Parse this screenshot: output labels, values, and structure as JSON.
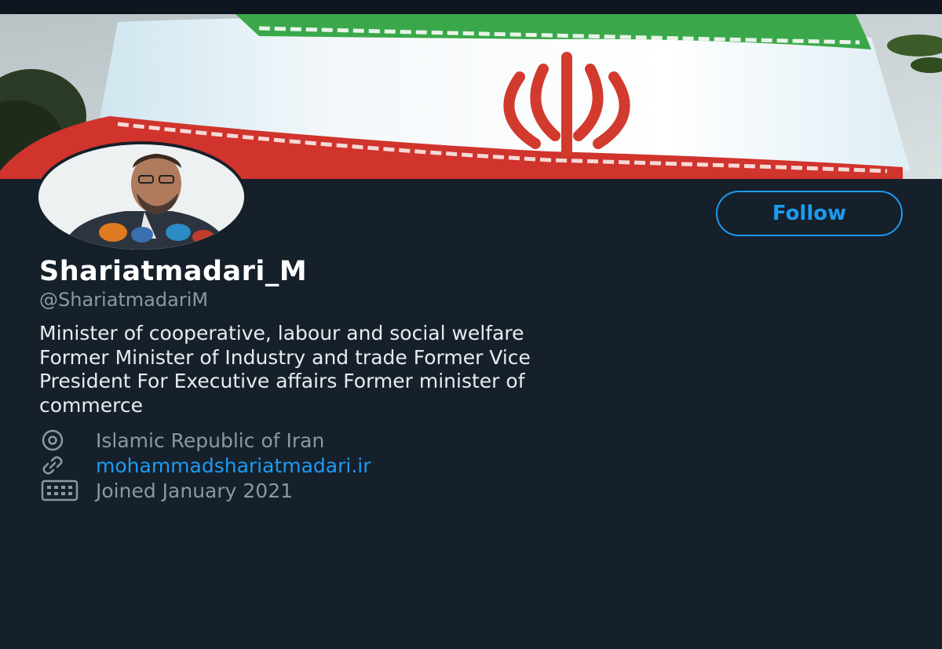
{
  "profile": {
    "display_name": "Shariatmadari_M",
    "handle": "@ShariatmadariM",
    "bio": "Minister of cooperative, labour and social welfare\nFormer Minister of Industry and trade Former Vice\nPresident For Executive affairs Former minister of\ncommerce",
    "location": "Islamic Republic of Iran",
    "website": "mohammadshariatmadari.ir",
    "joined": "Joined January 2021"
  },
  "actions": {
    "follow_label": "Follow"
  },
  "icons": {
    "location": "location-pin-icon",
    "website": "link-icon",
    "joined": "calendar-icon"
  },
  "colors": {
    "background": "#15202b",
    "accent": "#1d9bf0",
    "secondary_text": "#8899a6"
  }
}
